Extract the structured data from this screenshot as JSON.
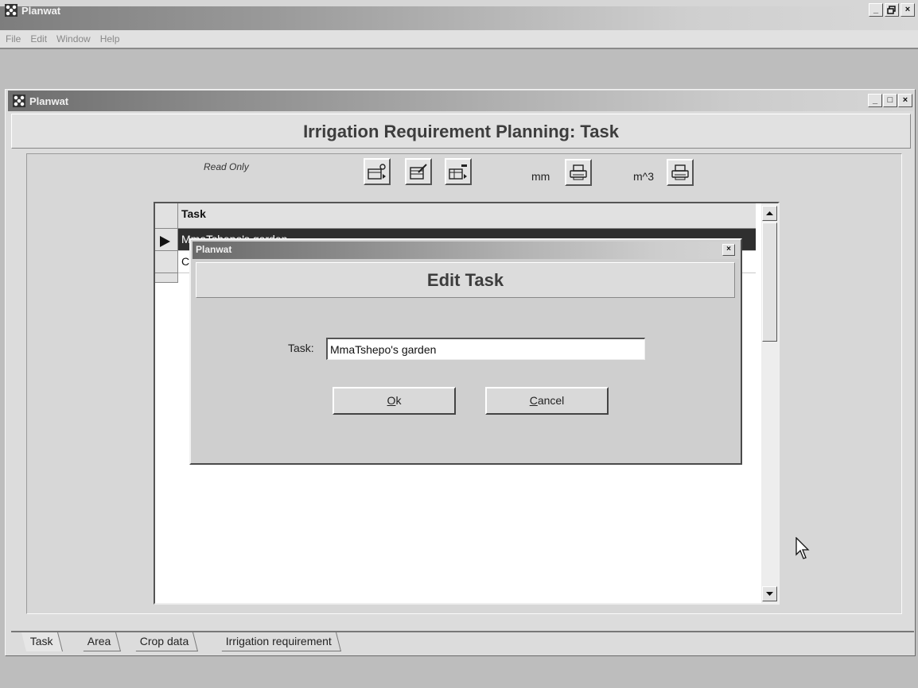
{
  "app": {
    "title": "Planwat",
    "menu": [
      "File",
      "Edit",
      "Window",
      "Help"
    ],
    "window_buttons": [
      "_",
      "Ơ",
      "×"
    ]
  },
  "child": {
    "title": "Planwat",
    "window_buttons": [
      "_",
      "□",
      "×"
    ],
    "header": "Irrigation Requirement Planning: Task",
    "read_only": "Read Only",
    "unit_mm": "mm",
    "unit_m3": "m^3",
    "toolbar_icons": [
      "add-record-icon",
      "edit-record-icon",
      "delete-record-icon",
      "print-icon"
    ]
  },
  "grid": {
    "column": "Task",
    "rows": [
      "MmaTshepo's garden",
      "C"
    ],
    "selected_row": 0
  },
  "dialog": {
    "title": "Planwat",
    "close": "×",
    "header": "Edit Task",
    "task_label": "Task:",
    "task_value": "MmaTshepo's garden",
    "ok_accel": "O",
    "ok_rest": "k",
    "cancel_accel": "C",
    "cancel_rest": "ancel"
  },
  "tabs": [
    "Task",
    "Area",
    "Crop data",
    "Irrigation requirement"
  ],
  "active_tab": "Task"
}
